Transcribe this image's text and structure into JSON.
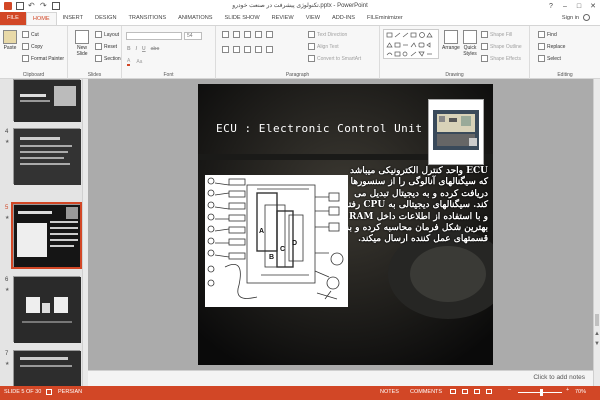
{
  "window": {
    "title": "تکنولوژی پیشرفت در صنعت خودرو.pptx - PowerPoint",
    "controls": [
      "?",
      "–",
      "□",
      "✕"
    ]
  },
  "tabs": [
    {
      "label": "FILE",
      "key": "file"
    },
    {
      "label": "HOME",
      "key": "home",
      "active": true
    },
    {
      "label": "INSERT",
      "key": "insert"
    },
    {
      "label": "DESIGN",
      "key": "design"
    },
    {
      "label": "TRANSITIONS",
      "key": "transitions"
    },
    {
      "label": "ANIMATIONS",
      "key": "animations"
    },
    {
      "label": "SLIDE SHOW",
      "key": "slideshow"
    },
    {
      "label": "REVIEW",
      "key": "review"
    },
    {
      "label": "VIEW",
      "key": "view"
    },
    {
      "label": "ADD-INS",
      "key": "addins"
    },
    {
      "label": "FILEminimizer",
      "key": "fileminimizer"
    }
  ],
  "signin": "Sign in",
  "ribbon": {
    "clipboard": {
      "label": "Clipboard",
      "paste": "Paste",
      "cut": "Cut",
      "copy": "Copy",
      "format_painter": "Format Painter"
    },
    "slides": {
      "label": "Slides",
      "new_slide": "New Slide",
      "layout": "Layout",
      "reset": "Reset",
      "section": "Section"
    },
    "font": {
      "label": "Font",
      "size": "54"
    },
    "paragraph": {
      "label": "Paragraph",
      "text_direction": "Text Direction",
      "align_text": "Align Text",
      "convert_smartart": "Convert to SmartArt"
    },
    "drawing": {
      "label": "Drawing",
      "arrange": "Arrange",
      "quick_styles": "Quick Styles",
      "shape_fill": "Shape Fill",
      "shape_outline": "Shape Outline",
      "shape_effects": "Shape Effects"
    },
    "editing": {
      "label": "Editing",
      "find": "Find",
      "replace": "Replace",
      "select": "Select"
    }
  },
  "thumbnails": [
    {
      "num": "",
      "selected": false
    },
    {
      "num": "4",
      "selected": false
    },
    {
      "num": "5",
      "selected": true
    },
    {
      "num": "6",
      "selected": false
    },
    {
      "num": "7",
      "selected": false
    }
  ],
  "slide": {
    "title": "ECU : Electronic Control Unit",
    "body": "ECU واحد کنترل الکترونیکی میباشد که سیگنالهای آنالوگی را از سنسورها دریافت کرده و به دیجیتال تبدیل می کند. سیگنالهای دیجیتالی به CPU رفته و با استفاده از اطلاعات داخل RAM بهترین شکل فرمان محاسبه کرده و به قسمتهای عمل کننده ارسال میکند.",
    "diagram_labels": [
      "A",
      "B",
      "C",
      "D"
    ]
  },
  "notes_placeholder": "Click to add notes",
  "status": {
    "slide_info": "SLIDE 5 OF 30",
    "language": "PERSIAN",
    "notes": "NOTES",
    "comments": "COMMENTS",
    "zoom": "70%"
  },
  "colors": {
    "accent": "#d24726",
    "ribbon_bg": "#f7f7f7",
    "workspace": "#ababab"
  }
}
